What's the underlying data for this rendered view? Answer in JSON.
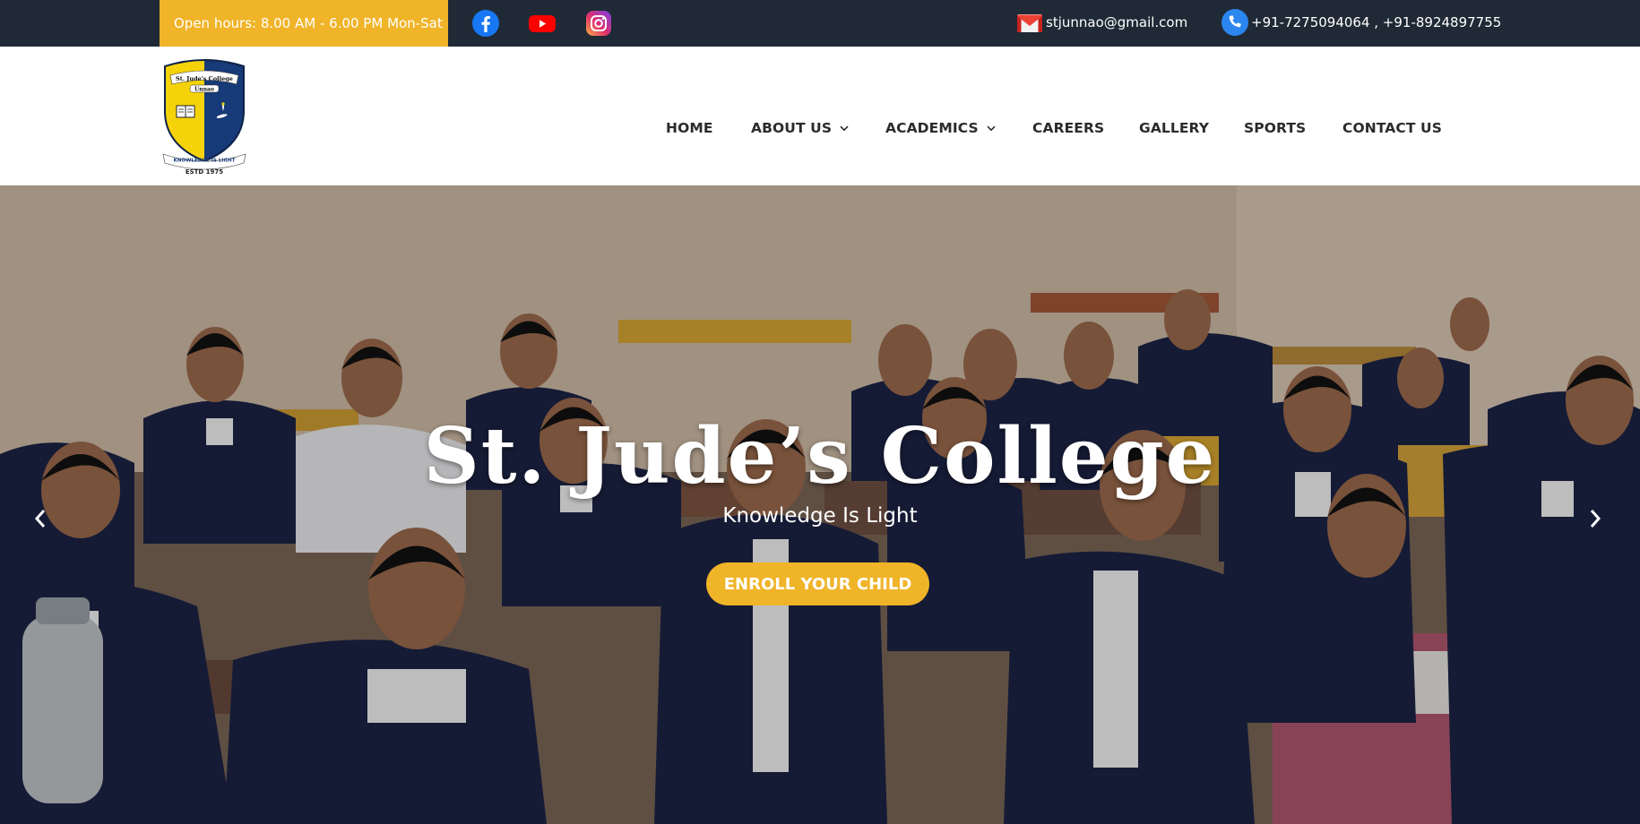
{
  "topbar": {
    "hours": "Open hours: 8.00 AM - 6.00 PM Mon-Sat",
    "email": "stjunnao@gmail.com",
    "phone": "+91-7275094064 , +91-8924897755",
    "social": [
      {
        "icon": "facebook-icon"
      },
      {
        "icon": "youtube-icon"
      },
      {
        "icon": "instagram-icon"
      }
    ]
  },
  "logo": {
    "crest_name": "St. Jude's College",
    "crest_place": "Unnao",
    "motto": "KNOWLEDGE IS LIGHT",
    "estd": "ESTD 1975"
  },
  "nav": {
    "items": [
      {
        "label": "HOME"
      },
      {
        "label": "ABOUT US",
        "dropdown": true
      },
      {
        "label": "ACADEMICS",
        "dropdown": true
      },
      {
        "label": "CAREERS"
      },
      {
        "label": "GALLERY"
      },
      {
        "label": "SPORTS"
      },
      {
        "label": "CONTACT US"
      }
    ]
  },
  "hero": {
    "title": "St. Jude’s College",
    "subtitle": "Knowledge Is Light",
    "cta": "ENROLL YOUR CHILD",
    "prev_icon": "chevron-left-icon",
    "next_icon": "chevron-right-icon"
  },
  "colors": {
    "topbar_bg": "#1f2a36",
    "accent": "#f0b429",
    "nav_text": "#2b2b2b",
    "crest_yellow": "#f5d20a",
    "crest_navy": "#173a78"
  }
}
